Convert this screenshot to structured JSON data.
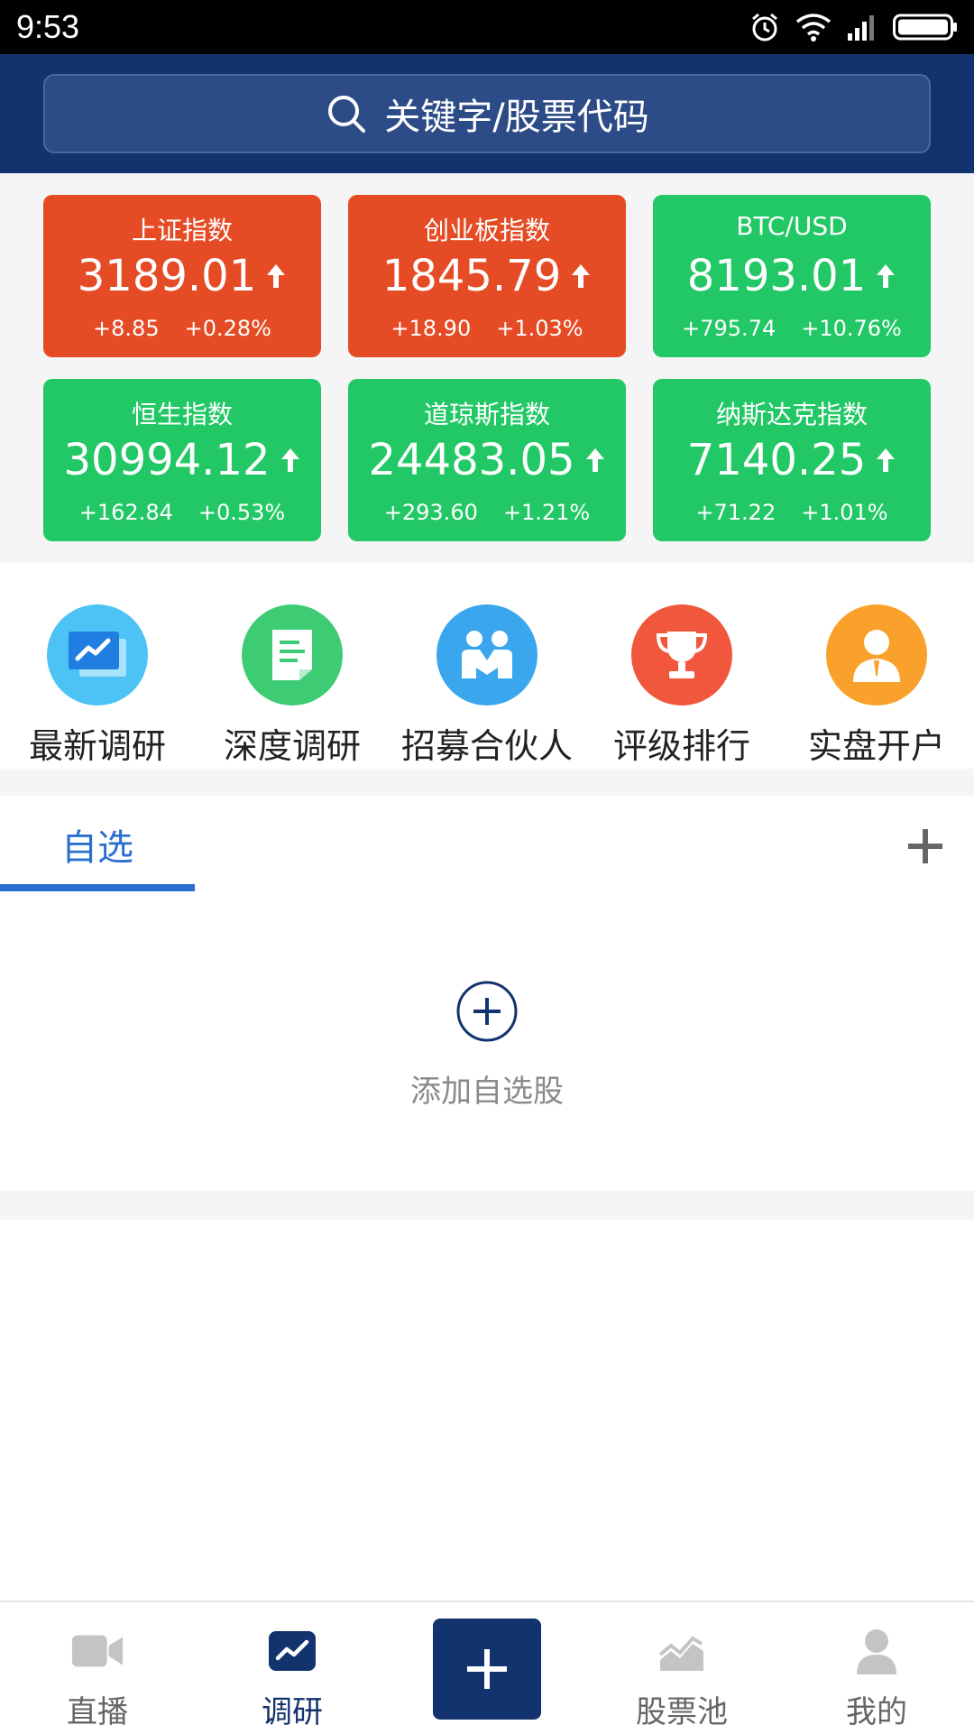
{
  "status_bar": {
    "time": "9:53"
  },
  "search": {
    "placeholder": "关键字/股票代码"
  },
  "indices": [
    {
      "name": "上证指数",
      "value": "3189.01",
      "change": "+8.85",
      "percent": "+0.28%",
      "color": "#e54b24"
    },
    {
      "name": "创业板指数",
      "value": "1845.79",
      "change": "+18.90",
      "percent": "+1.03%",
      "color": "#e54b24"
    },
    {
      "name": "BTC/USD",
      "value": "8193.01",
      "change": "+795.74",
      "percent": "+10.76%",
      "color": "#22c865"
    },
    {
      "name": "恒生指数",
      "value": "30994.12",
      "change": "+162.84",
      "percent": "+0.53%",
      "color": "#22c865"
    },
    {
      "name": "道琼斯指数",
      "value": "24483.05",
      "change": "+293.60",
      "percent": "+1.21%",
      "color": "#22c865"
    },
    {
      "name": "纳斯达克指数",
      "value": "7140.25",
      "change": "+71.22",
      "percent": "+1.01%",
      "color": "#22c865"
    }
  ],
  "features": [
    {
      "label": "最新调研",
      "icon": "chart-monitor-icon",
      "color": "#4cc2f5"
    },
    {
      "label": "深度调研",
      "icon": "document-icon",
      "color": "#3dcc74"
    },
    {
      "label": "招募合伙人",
      "icon": "partners-icon",
      "color": "#3aa6ee"
    },
    {
      "label": "评级排行",
      "icon": "trophy-icon",
      "color": "#f1573c"
    },
    {
      "label": "实盘开户",
      "icon": "person-icon",
      "color": "#f9a12a"
    }
  ],
  "watchlist": {
    "tab_label": "自选",
    "empty_text": "添加自选股"
  },
  "bottom_nav": [
    {
      "label": "直播",
      "icon": "video-icon"
    },
    {
      "label": "调研",
      "icon": "trend-icon",
      "active": true
    },
    {
      "label": "",
      "icon": "plus-icon"
    },
    {
      "label": "股票池",
      "icon": "stock-pool-icon"
    },
    {
      "label": "我的",
      "icon": "user-icon"
    }
  ],
  "colors": {
    "header": "#12336e",
    "accent": "#2a6fd0",
    "up_red": "#e54b24",
    "up_green": "#22c865"
  }
}
